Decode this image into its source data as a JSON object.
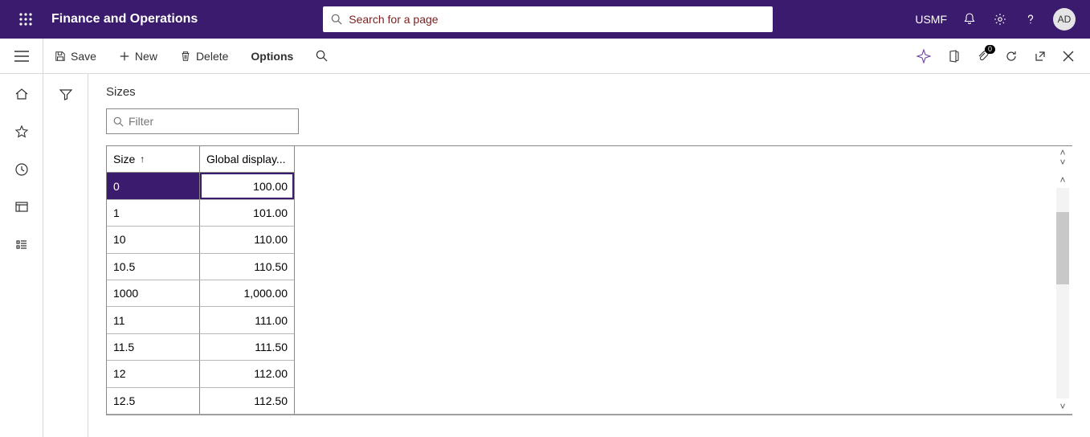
{
  "header": {
    "app_title": "Finance and Operations",
    "search_placeholder": "Search for a page",
    "company": "USMF",
    "avatar": "AD"
  },
  "toolbar": {
    "save": "Save",
    "new": "New",
    "delete": "Delete",
    "options": "Options",
    "attach_count": "0"
  },
  "page": {
    "title": "Sizes",
    "filter_placeholder": "Filter"
  },
  "grid": {
    "columns": {
      "size": "Size",
      "display": "Global display..."
    },
    "edit_value": "100.00",
    "rows": [
      {
        "size": "0",
        "display": "100.00"
      },
      {
        "size": "1",
        "display": "101.00"
      },
      {
        "size": "10",
        "display": "110.00"
      },
      {
        "size": "10.5",
        "display": "110.50"
      },
      {
        "size": "1000",
        "display": "1,000.00"
      },
      {
        "size": "11",
        "display": "111.00"
      },
      {
        "size": "11.5",
        "display": "111.50"
      },
      {
        "size": "12",
        "display": "112.00"
      },
      {
        "size": "12.5",
        "display": "112.50"
      }
    ]
  }
}
